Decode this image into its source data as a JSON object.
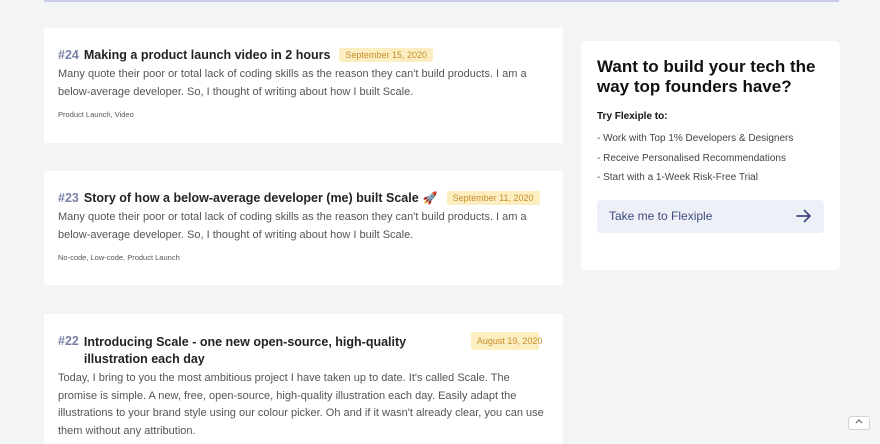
{
  "posts": [
    {
      "number": "#24",
      "title": "Making a product launch video in 2 hours",
      "date": "September 15, 2020",
      "excerpt": "Many quote their poor or total lack of coding skills as the reason they can't build products. I am a below-average developer. So, I thought of writing about how I built Scale.",
      "tags": "Product Launch, Video"
    },
    {
      "number": "#23",
      "title": "Story of how a below-average developer (me) built Scale",
      "title_emoji": "🚀",
      "date": "September 11, 2020",
      "excerpt": "Many quote their poor or total lack of coding skills as the reason they can't build products. I am a below-average developer. So, I thought of writing about how I built Scale.",
      "tags": "No-code, Low-code, Product Launch"
    },
    {
      "number": "#22",
      "title": "Introducing Scale - one new open-source, high-quality illustration each day",
      "date": "August 19, 2020",
      "excerpt": "Today, I bring to you the most ambitious project I have taken up to date. It's called Scale. The promise is simple. A new, free, open-source, high-quality illustration each day. Easily adapt the illustrations to your brand style using our colour picker. Oh and if it wasn't already clear, you can use them without any attribution."
    }
  ],
  "sidebar": {
    "title": "Want to build your tech the way top founders have?",
    "subtitle": "Try Flexiple to:",
    "items": [
      "- Work with Top 1% Developers & Designers",
      "- Receive Personalised Recommendations",
      "- Start with a 1-Week Risk-Free Trial"
    ],
    "cta_label": "Take me to Flexiple",
    "cta_icon": "arrow-right-icon"
  },
  "colors": {
    "accent": "#3f4a80",
    "date_badge_bg": "#fdeec2",
    "date_badge_text": "#c58f2a",
    "page_bg": "#f3f4f6"
  }
}
